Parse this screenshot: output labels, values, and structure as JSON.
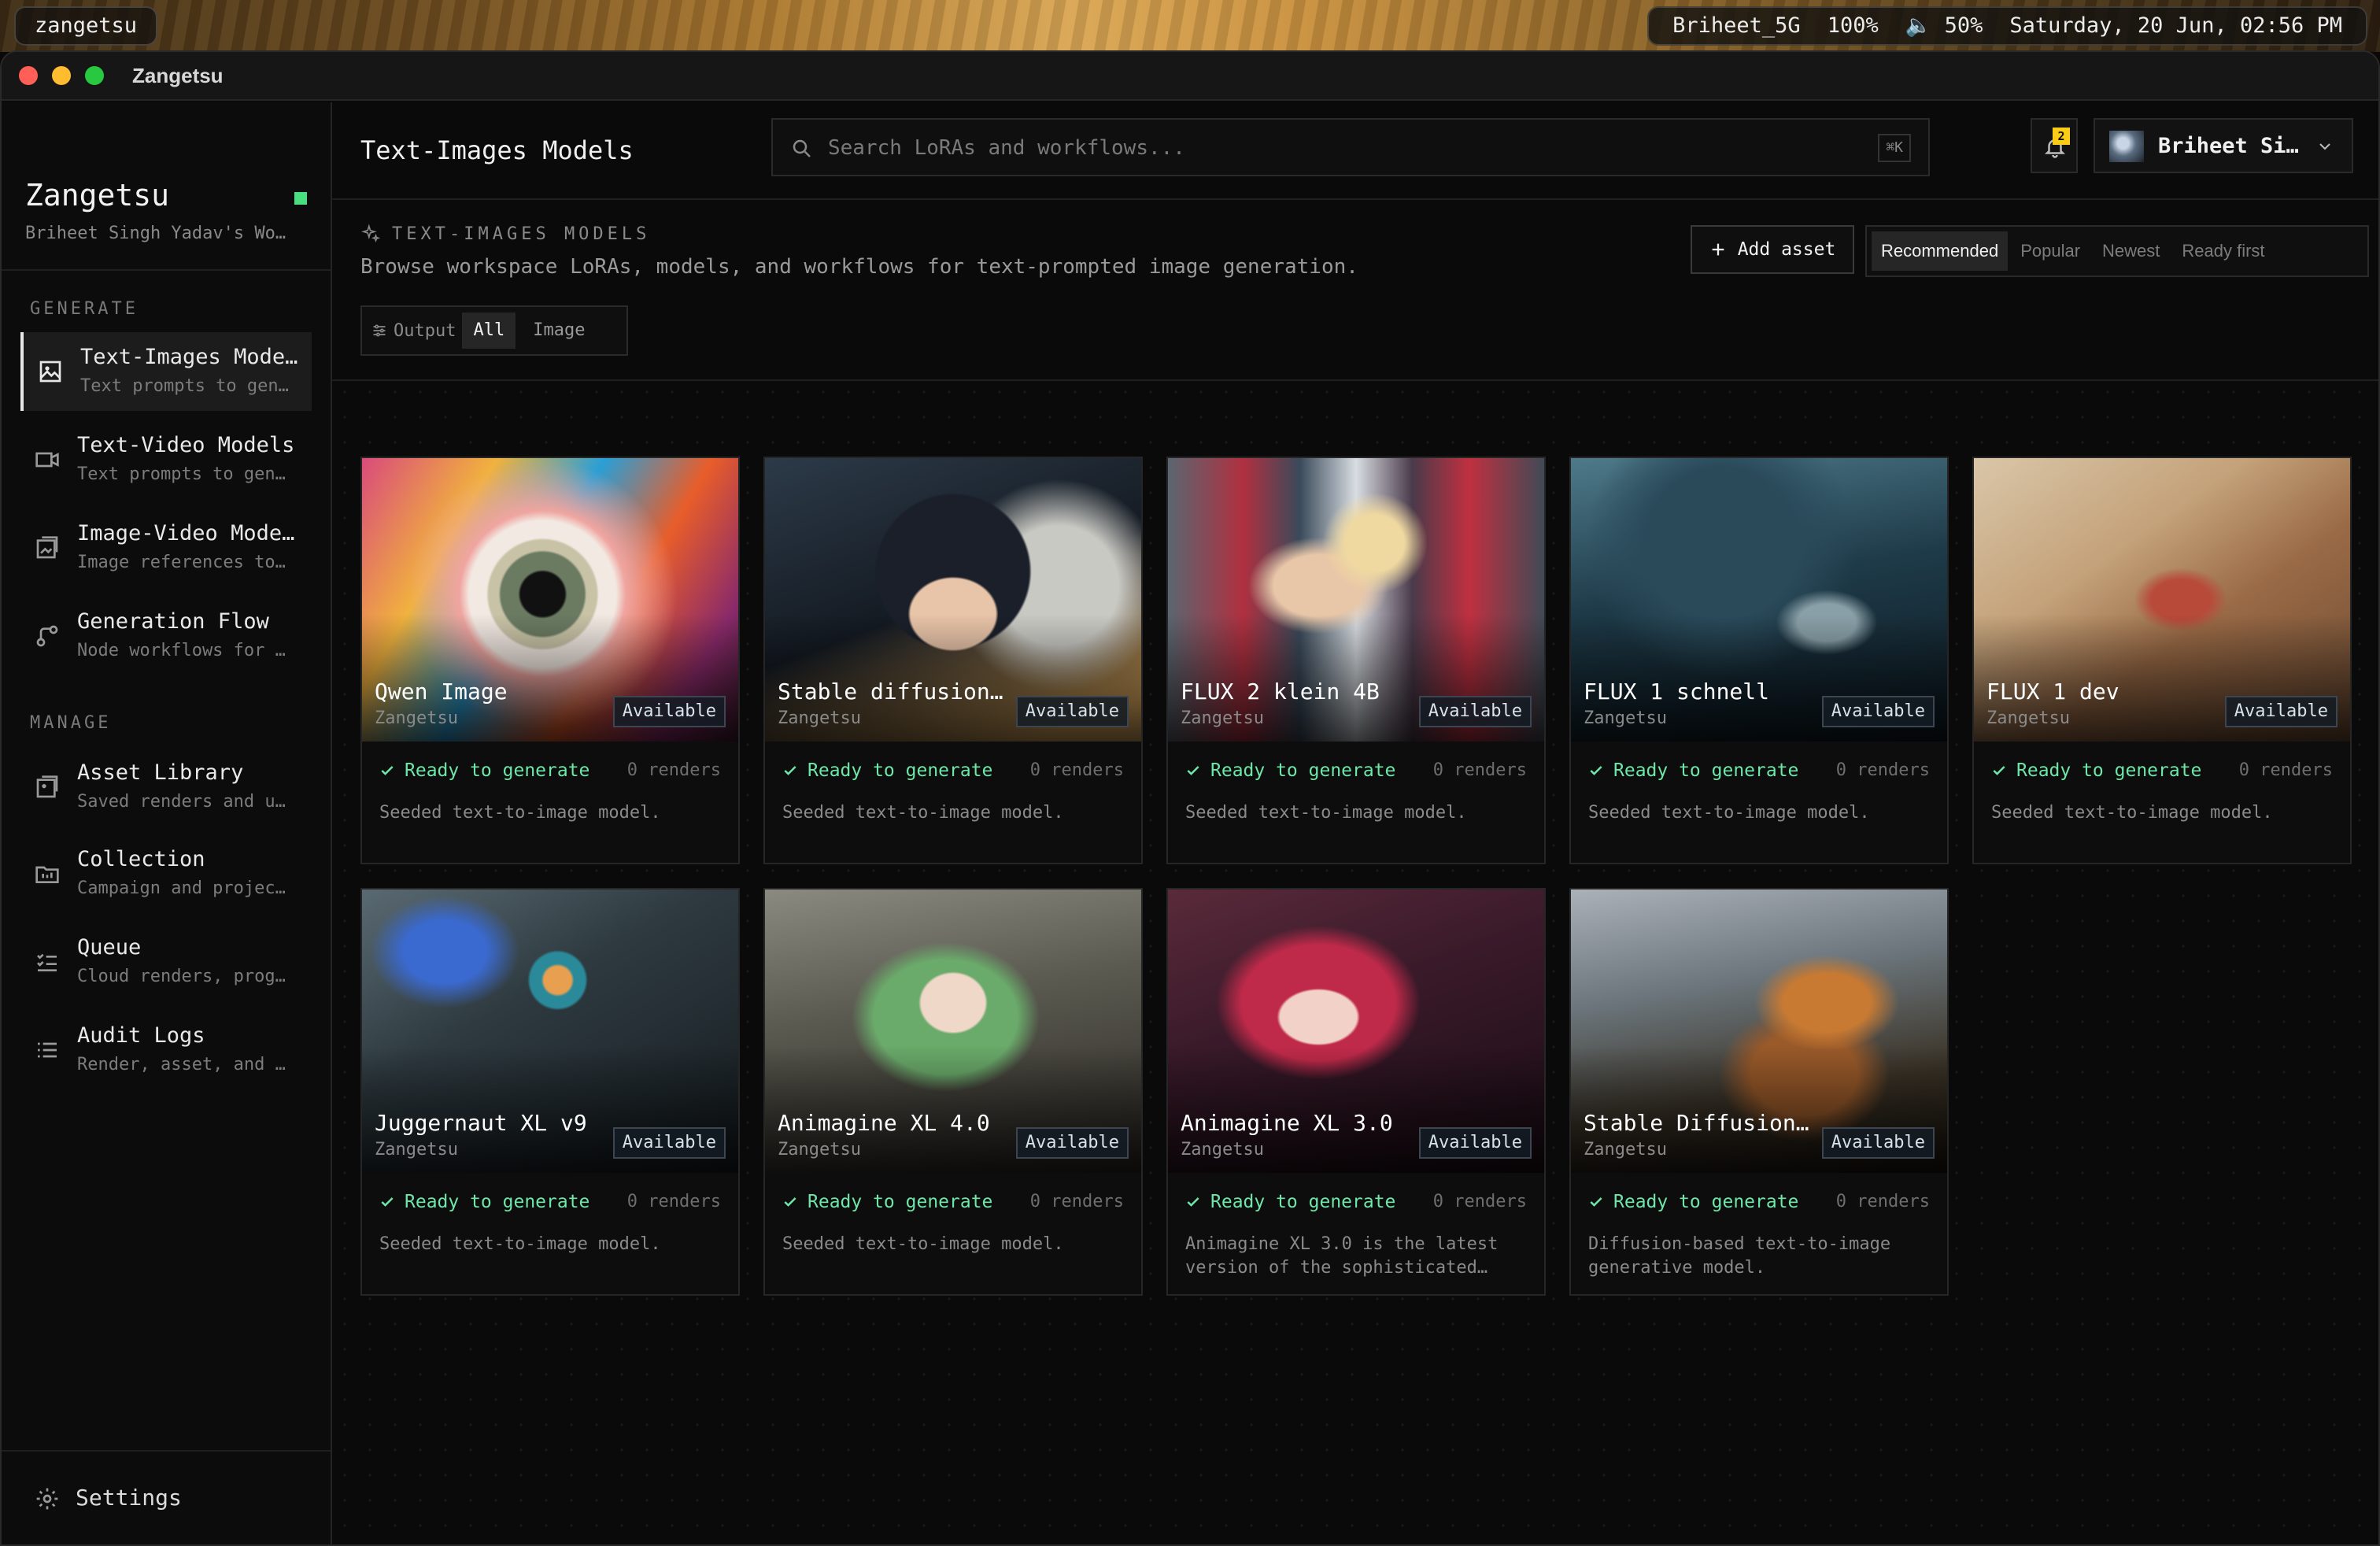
{
  "menubar": {
    "app_name": "zangetsu",
    "wifi": "Briheet_5G",
    "battery": "100%",
    "volume": "🔈 50%",
    "datetime": "Saturday, 20 Jun, 02:56 PM"
  },
  "window": {
    "title": "Zangetsu"
  },
  "sidebar": {
    "workspace_name": "Zangetsu",
    "workspace_sub": "Briheet Singh Yadav's Wo…",
    "generate_label": "GENERATE",
    "manage_label": "MANAGE",
    "generate_items": [
      {
        "title": "Text-Images Mode…",
        "sub": "Text prompts to gen…",
        "icon": "image-icon"
      },
      {
        "title": "Text-Video Models",
        "sub": "Text prompts to gen…",
        "icon": "video-icon"
      },
      {
        "title": "Image-Video Mode…",
        "sub": "Image references to…",
        "icon": "image-video-icon"
      },
      {
        "title": "Generation Flow",
        "sub": "Node workflows for …",
        "icon": "flow-icon"
      }
    ],
    "manage_items": [
      {
        "title": "Asset Library",
        "sub": "Saved renders and u…",
        "icon": "library-icon"
      },
      {
        "title": "Collection",
        "sub": "Campaign and projec…",
        "icon": "folder-icon"
      },
      {
        "title": "Queue",
        "sub": "Cloud renders, prog…",
        "icon": "queue-icon"
      },
      {
        "title": "Audit Logs",
        "sub": "Render, asset, and …",
        "icon": "list-icon"
      }
    ],
    "settings_label": "Settings"
  },
  "topbar": {
    "title": "Text-Images Models",
    "search_placeholder": "Search LoRAs and workflows...",
    "search_shortcut": "⌘K",
    "notification_count": "2",
    "user_name": "Briheet Si…"
  },
  "header": {
    "eyebrow": "TEXT-IMAGES MODELS",
    "description": "Browse workspace LoRAs, models, and workflows for text-prompted image generation.",
    "add_asset_label": "Add asset",
    "sort_options": [
      "Recommended",
      "Popular",
      "Newest",
      "Ready first"
    ],
    "sort_selected": "Recommended",
    "filter_label": "Output",
    "filter_options": [
      "All",
      "Image"
    ],
    "filter_selected": "All"
  },
  "cards": [
    {
      "title": "Qwen Image",
      "owner": "Zangetsu",
      "status": "Available",
      "ready": "Ready to generate",
      "renders": "0 renders",
      "desc": "Seeded text-to-image model."
    },
    {
      "title": "Stable diffusion…",
      "owner": "Zangetsu",
      "status": "Available",
      "ready": "Ready to generate",
      "renders": "0 renders",
      "desc": "Seeded text-to-image model."
    },
    {
      "title": "FLUX 2 klein 4B",
      "owner": "Zangetsu",
      "status": "Available",
      "ready": "Ready to generate",
      "renders": "0 renders",
      "desc": "Seeded text-to-image model."
    },
    {
      "title": "FLUX 1 schnell",
      "owner": "Zangetsu",
      "status": "Available",
      "ready": "Ready to generate",
      "renders": "0 renders",
      "desc": "Seeded text-to-image model."
    },
    {
      "title": "FLUX 1 dev",
      "owner": "Zangetsu",
      "status": "Available",
      "ready": "Ready to generate",
      "renders": "0 renders",
      "desc": "Seeded text-to-image model."
    },
    {
      "title": "Juggernaut XL v9",
      "owner": "Zangetsu",
      "status": "Available",
      "ready": "Ready to generate",
      "renders": "0 renders",
      "desc": "Seeded text-to-image model."
    },
    {
      "title": "Animagine XL 4.0",
      "owner": "Zangetsu",
      "status": "Available",
      "ready": "Ready to generate",
      "renders": "0 renders",
      "desc": "Seeded text-to-image model."
    },
    {
      "title": "Animagine XL 3.0",
      "owner": "Zangetsu",
      "status": "Available",
      "ready": "Ready to generate",
      "renders": "0 renders",
      "desc": "Animagine XL 3.0 is the latest version of the sophisticated…"
    },
    {
      "title": "Stable Diffusion…",
      "owner": "Zangetsu",
      "status": "Available",
      "ready": "Ready to generate",
      "renders": "0 renders",
      "desc": "Diffusion-based text-to-image generative model."
    }
  ],
  "colors": {
    "accent_ready": "#6ee7a8",
    "workspace_dot": "#4ade80",
    "notification_badge": "#facc15"
  }
}
